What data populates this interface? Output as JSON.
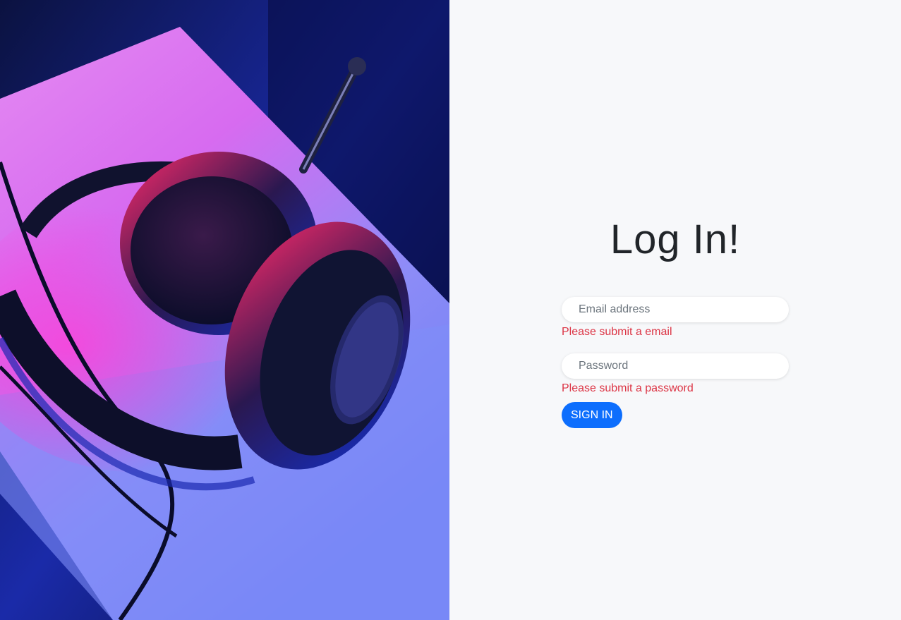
{
  "login": {
    "title": "Log In!",
    "email_placeholder": "Email address",
    "email_error": "Please submit a email",
    "password_placeholder": "Password",
    "password_error": "Please submit a password",
    "submit_label": "SIGN IN"
  },
  "hero": {
    "image_subject": "headphones-on-neon-lit-desk"
  },
  "colors": {
    "accent": "#0d6efd",
    "error": "#dc3545",
    "panel_bg": "#f7f8fa",
    "title": "#212529"
  }
}
